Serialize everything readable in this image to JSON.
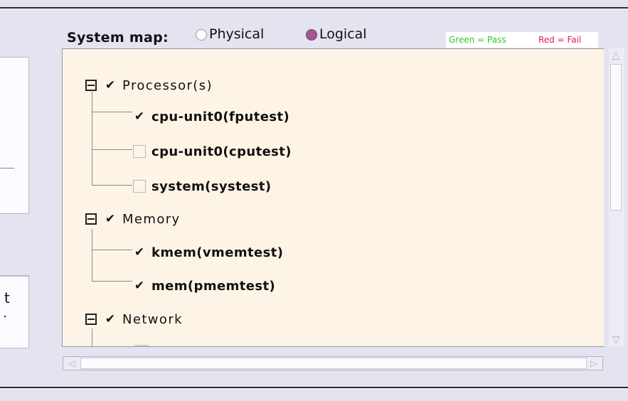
{
  "system_map": {
    "label": "System map:",
    "options": [
      {
        "label": "Physical",
        "selected": false
      },
      {
        "label": "Logical",
        "selected": true
      }
    ]
  },
  "legend": {
    "pass_label": "Green = Pass",
    "fail_label": "Red = Fail",
    "pass_color": "#2ec52e",
    "fail_color": "#e0204c"
  },
  "left_panel": {
    "lower_box_text": "t"
  },
  "tree": {
    "groups": [
      {
        "label": "Processor(s)",
        "checked": true,
        "expanded": true,
        "children": [
          {
            "label": "cpu-unit0(fputest)",
            "checked": true
          },
          {
            "label": "cpu-unit0(cputest)",
            "checked": false
          },
          {
            "label": "system(systest)",
            "checked": false
          }
        ]
      },
      {
        "label": "Memory",
        "checked": true,
        "expanded": true,
        "children": [
          {
            "label": "kmem(vmemtest)",
            "checked": true
          },
          {
            "label": "mem(pmemtest)",
            "checked": true
          }
        ]
      },
      {
        "label": "Network",
        "checked": true,
        "expanded": true,
        "children": []
      }
    ]
  },
  "icons": {
    "check": "✔",
    "scroll_up": "△",
    "scroll_down": "▽",
    "scroll_left": "◁",
    "scroll_right": "▷"
  }
}
